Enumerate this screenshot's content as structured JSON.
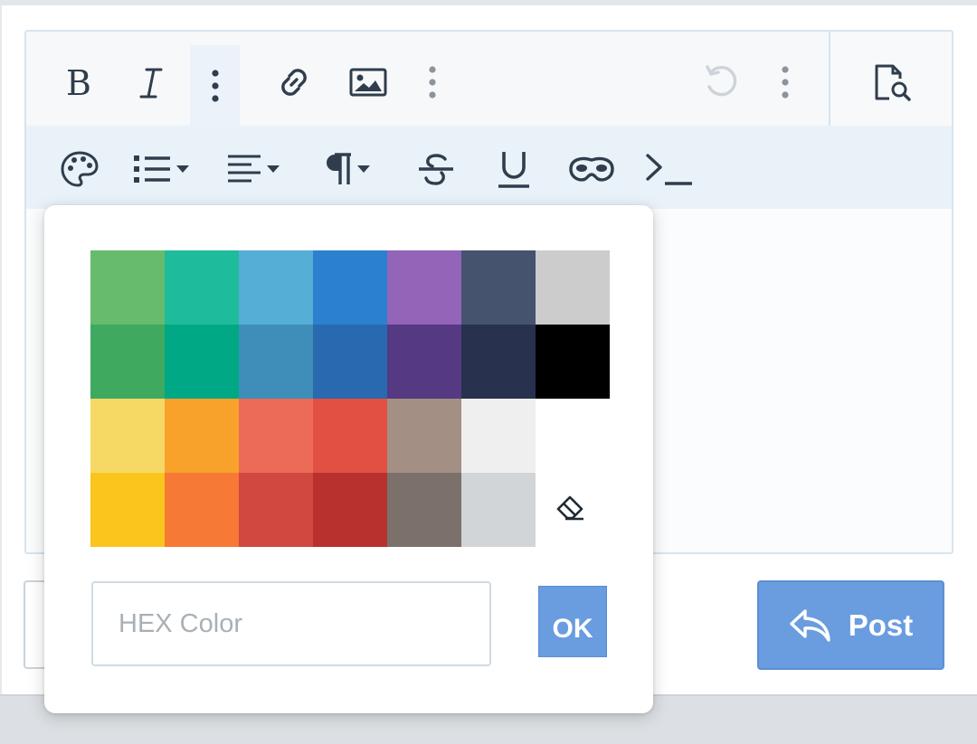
{
  "toolbar": {
    "buttons": [
      {
        "name": "bold-button",
        "icon": "bold-icon"
      },
      {
        "name": "italic-button",
        "icon": "italic-icon"
      },
      {
        "name": "more-text-options-button",
        "icon": "vertical-dots-icon"
      },
      {
        "name": "link-button",
        "icon": "link-icon"
      },
      {
        "name": "image-button",
        "icon": "image-icon"
      },
      {
        "name": "more-insert-options-button",
        "icon": "vertical-dots-icon"
      },
      {
        "name": "undo-button",
        "icon": "undo-icon"
      },
      {
        "name": "more-options-button",
        "icon": "vertical-dots-icon"
      },
      {
        "name": "preview-button",
        "icon": "document-search-icon"
      }
    ],
    "secondary_buttons": [
      {
        "name": "text-color-button",
        "icon": "palette-icon"
      },
      {
        "name": "list-dropdown-button",
        "icon": "list-icon"
      },
      {
        "name": "align-dropdown-button",
        "icon": "align-left-icon"
      },
      {
        "name": "paragraph-dropdown-button",
        "icon": "paragraph-icon"
      },
      {
        "name": "strikethrough-button",
        "icon": "strikethrough-icon"
      },
      {
        "name": "underline-button",
        "icon": "underline-icon"
      },
      {
        "name": "spoiler-button",
        "icon": "mask-icon"
      },
      {
        "name": "code-button",
        "icon": "terminal-icon"
      }
    ]
  },
  "color_picker": {
    "swatches": [
      [
        "#67bb6c",
        "#1ebc9c",
        "#55aed6",
        "#2b81cf",
        "#9364b8",
        "#45536f",
        "#cccccc"
      ],
      [
        "#3fa95f",
        "#00a885",
        "#3e8eb9",
        "#2969b0",
        "#553983",
        "#28324e",
        "#000000"
      ],
      [
        "#f6d965",
        "#f9a22b",
        "#eb6b56",
        "#e25041",
        "#a38f84",
        "#efefef",
        "#ffffff"
      ],
      [
        "#fac51c",
        "#f67936",
        "#d14841",
        "#b8312f",
        "#7c706b",
        "#d1d5d8",
        "#ffffff"
      ]
    ],
    "hex_placeholder": "HEX Color",
    "hex_value": "",
    "ok_label": "OK",
    "clear_icon": "eraser-icon"
  },
  "post_button": {
    "label": "Post",
    "icon": "reply-icon"
  },
  "colors": {
    "accent": "#6a9ce0",
    "toolbar_secondary_bg": "#eaf2f9",
    "icon": "#2f3d4d"
  }
}
